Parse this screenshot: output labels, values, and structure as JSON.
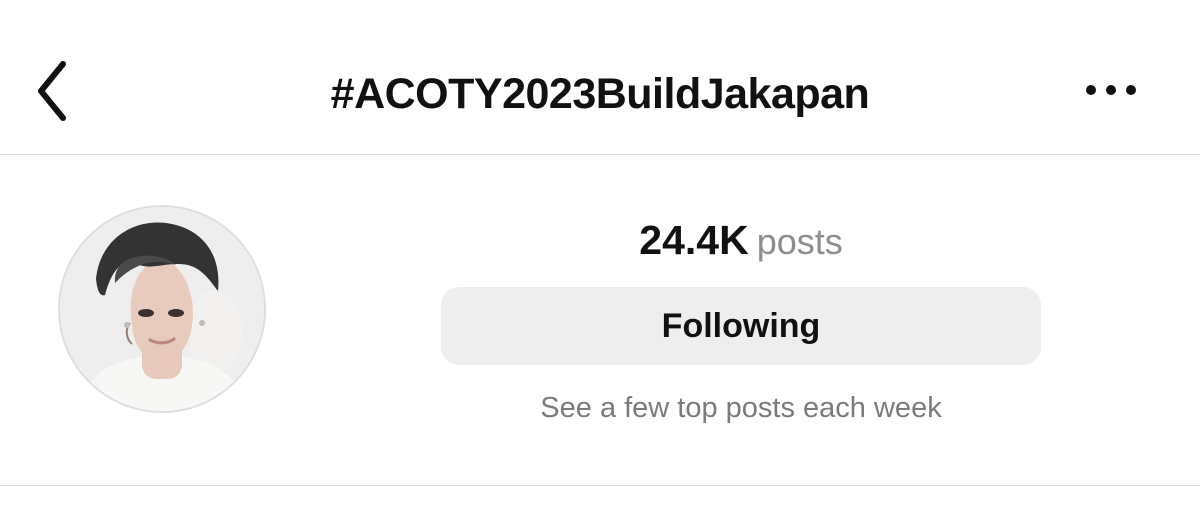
{
  "header": {
    "title": "#ACOTY2023BuildJakapan",
    "back_icon": "chevron-left-icon",
    "more_icon": "ellipsis-icon"
  },
  "profile": {
    "avatar": "profile-avatar",
    "posts_count": "24.4K",
    "posts_label": "posts",
    "follow_button_label": "Following",
    "helper_text": "See a few top posts each week"
  },
  "colors": {
    "background": "#ffffff",
    "title_text": "#111111",
    "secondary_text": "#8d8d8d",
    "button_background": "#eeeeee",
    "divider": "#dddddd"
  }
}
